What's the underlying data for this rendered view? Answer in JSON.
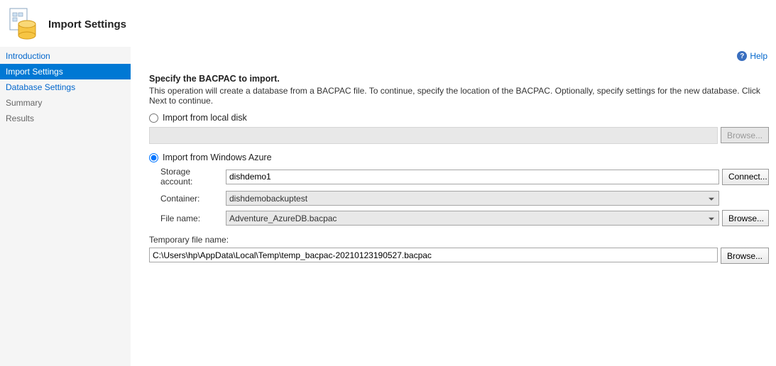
{
  "header": {
    "title": "Import Settings"
  },
  "help": {
    "label": "Help"
  },
  "sidebar": {
    "items": [
      {
        "label": "Introduction",
        "kind": "link"
      },
      {
        "label": "Import Settings",
        "kind": "selected"
      },
      {
        "label": "Database Settings",
        "kind": "link"
      },
      {
        "label": "Summary",
        "kind": "plain"
      },
      {
        "label": "Results",
        "kind": "plain"
      }
    ]
  },
  "main": {
    "heading": "Specify the BACPAC to import.",
    "description": "This operation will create a database from a BACPAC file. To continue, specify the location of the BACPAC.  Optionally, specify settings for the new database. Click Next to continue.",
    "radio_local": "Import from local disk",
    "radio_azure": "Import from Windows Azure",
    "browse_label": "Browse...",
    "connect_label": "Connect...",
    "storage_account_label": "Storage account:",
    "storage_account_value": "dishdemo1",
    "container_label": "Container:",
    "container_value": "dishdemobackuptest",
    "filename_label": "File name:",
    "filename_value": "Adventure_AzureDB.bacpac",
    "temp_label": "Temporary file name:",
    "temp_value": "C:\\Users\\hp\\AppData\\Local\\Temp\\temp_bacpac-20210123190527.bacpac"
  }
}
